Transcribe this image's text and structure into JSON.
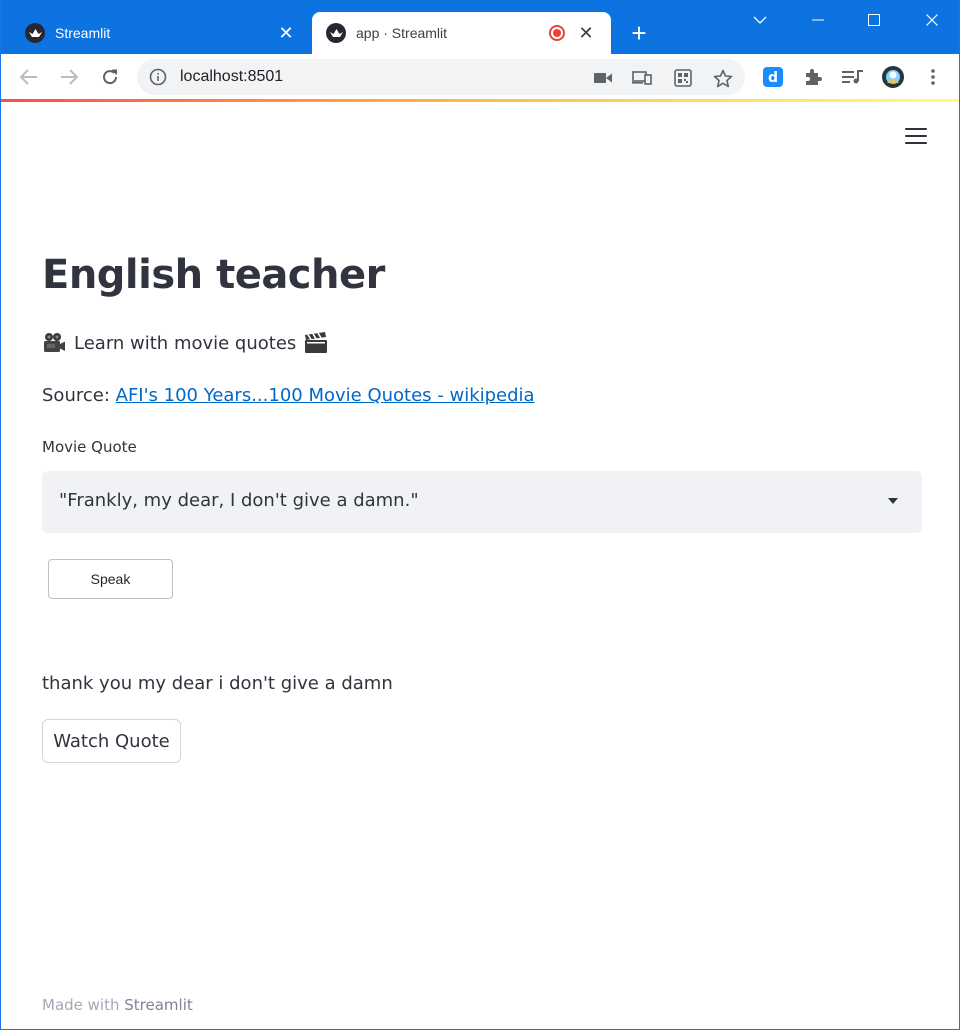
{
  "browser": {
    "tabs": [
      {
        "title": "Streamlit",
        "active": false
      },
      {
        "title": "app · Streamlit",
        "active": true,
        "recording": true
      }
    ],
    "url": "localhost:8501",
    "accent_color": "#0c73e0"
  },
  "app": {
    "title": "English teacher",
    "subtitle": "Learn with movie quotes",
    "source_prefix": "Source:",
    "source_link_text": "AFI's 100 Years...100 Movie Quotes - wikipedia",
    "select_label": "Movie Quote",
    "select_value": "\"Frankly, my dear, I don't give a damn.\"",
    "speak_label": "Speak",
    "transcript": "thank you my dear i don't give a damn",
    "watch_label": "Watch Quote",
    "footer_prefix": "Made with",
    "footer_brand": "Streamlit"
  }
}
